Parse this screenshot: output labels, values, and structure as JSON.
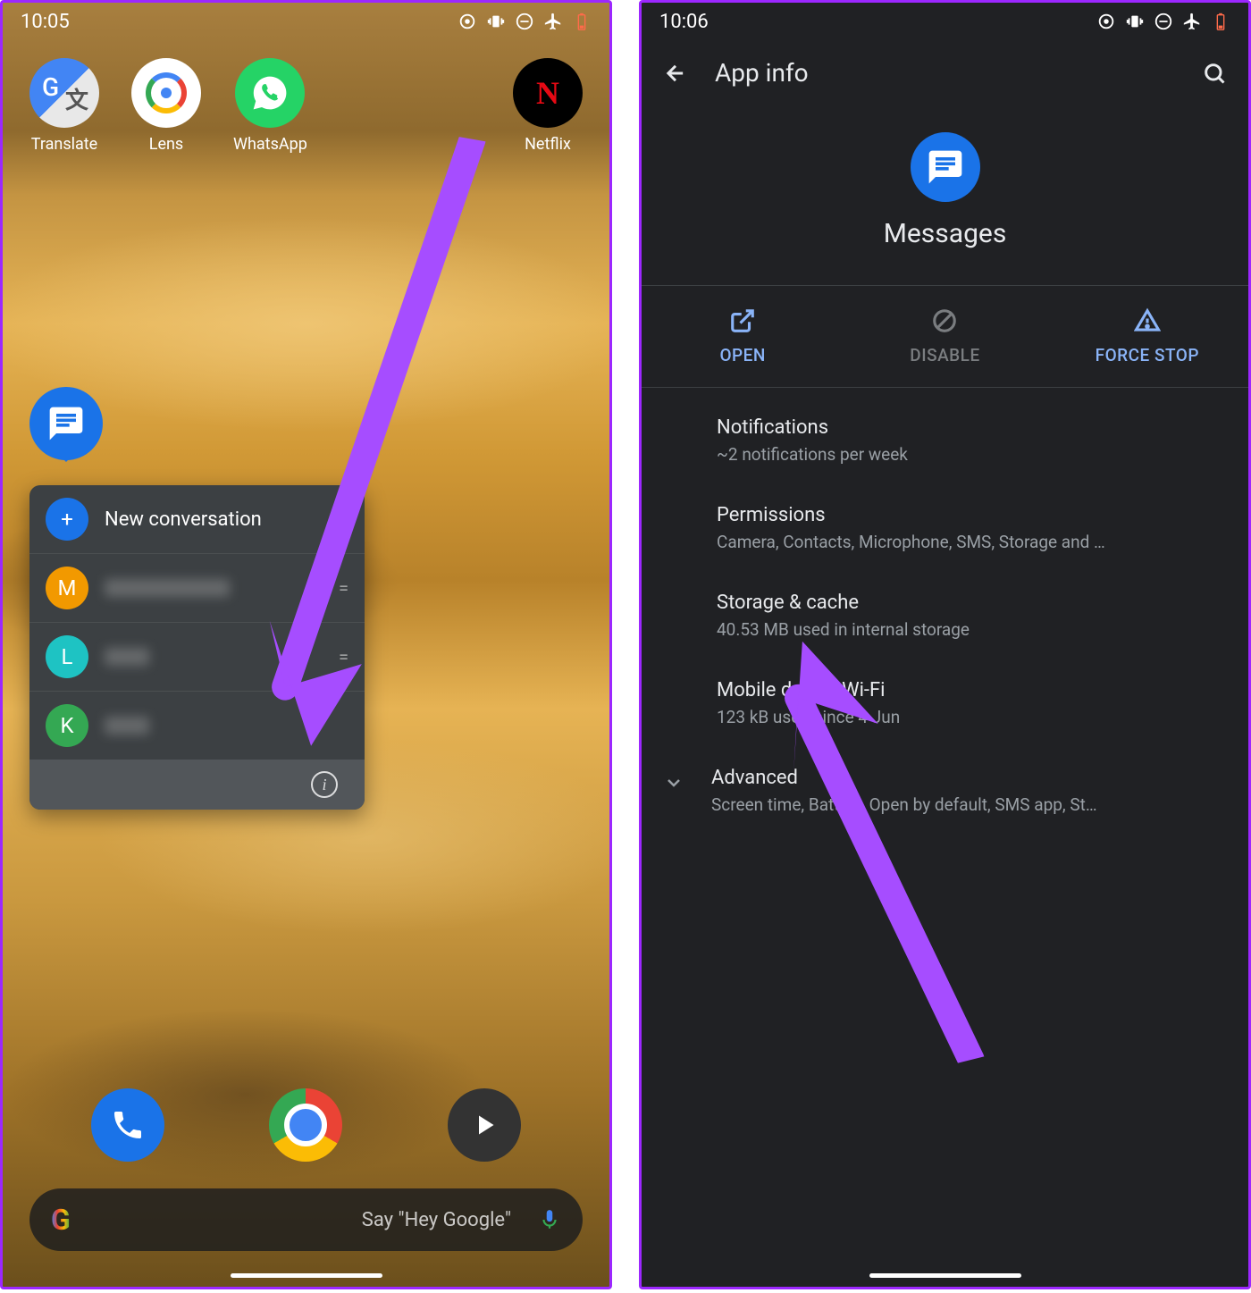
{
  "left": {
    "time": "10:05",
    "apps": [
      {
        "label": "Translate"
      },
      {
        "label": "Lens"
      },
      {
        "label": "WhatsApp"
      },
      {
        "label": "Netflix"
      }
    ],
    "shortcut": {
      "new_conv": "New conversation",
      "contacts": [
        {
          "initial": "M"
        },
        {
          "initial": "L"
        },
        {
          "initial": "K"
        }
      ]
    },
    "search_hint": "Say \"Hey Google\""
  },
  "right": {
    "time": "10:06",
    "header": "App info",
    "app_name": "Messages",
    "actions": {
      "open": "OPEN",
      "disable": "DISABLE",
      "force_stop": "FORCE STOP"
    },
    "settings": [
      {
        "title": "Notifications",
        "sub": "~2 notifications per week"
      },
      {
        "title": "Permissions",
        "sub": "Camera, Contacts, Microphone, SMS, Storage and …"
      },
      {
        "title": "Storage & cache",
        "sub": "40.53 MB used in internal storage"
      },
      {
        "title": "Mobile data & Wi‑Fi",
        "sub": "123 kB used since 4 Jun"
      },
      {
        "title": "Advanced",
        "sub": "Screen time, Battery, Open by default, SMS app, St…"
      }
    ]
  }
}
